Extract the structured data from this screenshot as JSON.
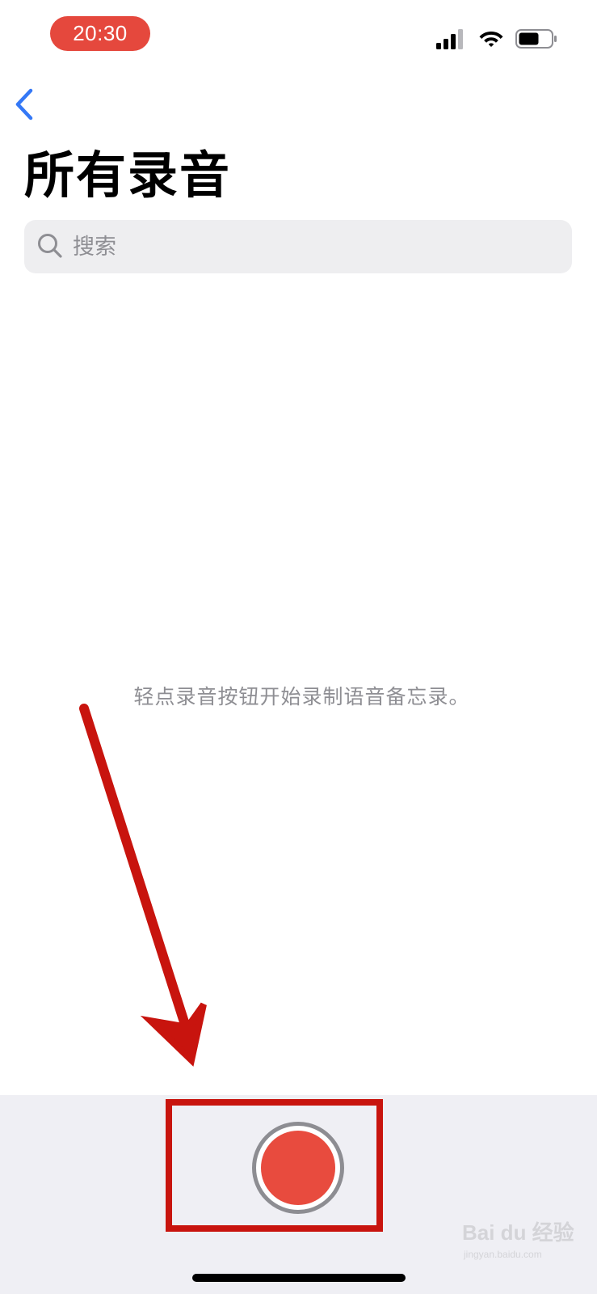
{
  "status_bar": {
    "time": "20:30",
    "time_pill_color": "#e5483d",
    "icons": [
      "cellular-signal-icon",
      "wifi-icon",
      "battery-icon"
    ]
  },
  "nav": {
    "back_icon": "chevron-left-icon",
    "accent_color": "#3478f6"
  },
  "page": {
    "title": "所有录音"
  },
  "search": {
    "placeholder": "搜索",
    "value": "",
    "icon": "search-icon"
  },
  "empty_state": {
    "message": "轻点录音按钮开始录制语音备忘录。"
  },
  "record": {
    "icon": "record-icon",
    "button_color": "#e84b3e"
  },
  "annotation": {
    "color": "#c8140e",
    "shapes": [
      "arrow",
      "highlight-box"
    ]
  },
  "watermark": {
    "brand": "Bai du 经验",
    "url": "jingyan.baidu.com"
  }
}
